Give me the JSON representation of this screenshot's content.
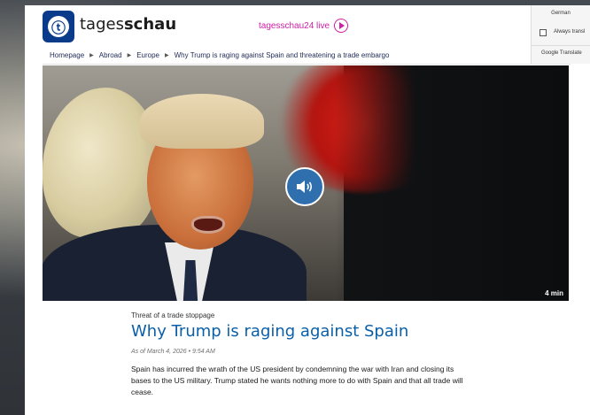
{
  "site": {
    "brand_light": "tages",
    "brand_bold": "schau",
    "live_label": "tagesschau24 live",
    "accent_color": "#d11ea6",
    "brand_color": "#0a3a8a"
  },
  "breadcrumb": [
    "Homepage",
    "Abroad",
    "Europe",
    "Why Trump is raging against Spain and threatening a trade embargo"
  ],
  "translate_popup": {
    "language": "German",
    "always_translate": "Always transl",
    "provider": "Google Translate"
  },
  "hero": {
    "audio_icon": "speaker-icon",
    "duration": "4 min"
  },
  "article": {
    "kicker": "Threat of a trade stoppage",
    "title": "Why Trump is raging against Spain",
    "date": "As of March 4, 2026 • 9:54 AM",
    "teaser": "Spain has incurred the wrath of the US president by condemning the war with Iran and closing its bases to the US military. Trump stated he wants nothing more to do with Spain and that all trade will cease.",
    "title_color": "#0a5fa8"
  }
}
